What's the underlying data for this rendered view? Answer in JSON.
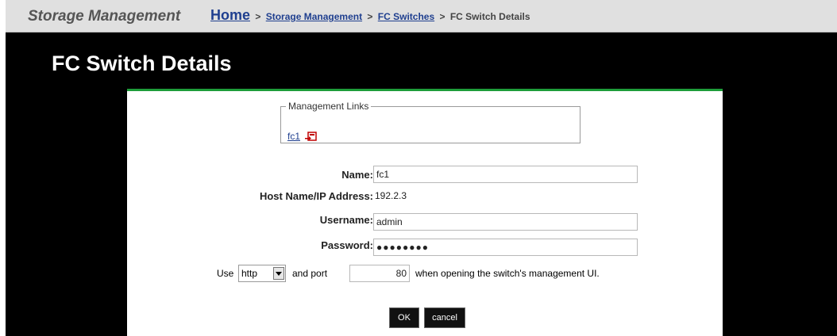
{
  "header": {
    "section_title": "Storage Management",
    "breadcrumbs": [
      "Home",
      "Storage Management",
      "FC Switches",
      "FC Switch Details"
    ],
    "separator": ">"
  },
  "page": {
    "title": "FC Switch Details"
  },
  "management_links": {
    "legend": "Management Links",
    "link_label": "fc1",
    "icon": "external-launch-icon"
  },
  "form": {
    "name": {
      "label": "Name:",
      "value": "fc1"
    },
    "host": {
      "label": "Host Name/IP Address:",
      "value": "192.2.3"
    },
    "username": {
      "label": "Username:",
      "value": "admin"
    },
    "password": {
      "label": "Password:",
      "value": "●●●●●●●●"
    },
    "protocol_sentence": {
      "prefix": "Use",
      "protocol": "http",
      "middle": "and port",
      "port": "80",
      "suffix": "when opening the switch's management UI."
    }
  },
  "buttons": {
    "ok": "OK",
    "cancel": "cancel"
  },
  "colors": {
    "accent_green": "#1e9c3a",
    "link_blue": "#1f3f8f",
    "frame": "#000000"
  }
}
